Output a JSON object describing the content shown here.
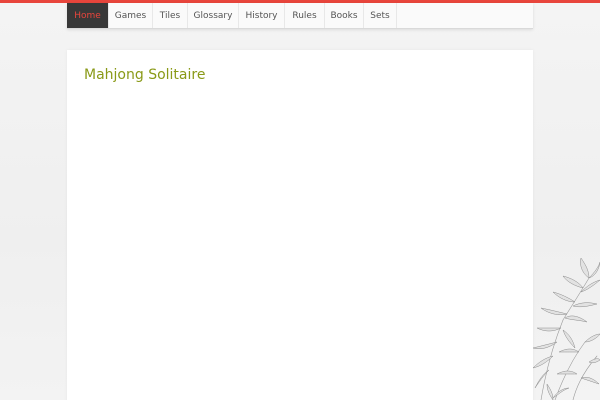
{
  "colors": {
    "accent_red": "#e8453c",
    "title_olive": "#8a9a18",
    "active_tab_bg": "#383838"
  },
  "nav": {
    "items": [
      {
        "label": "Home",
        "active": true
      },
      {
        "label": "Games"
      },
      {
        "label": "Tiles"
      },
      {
        "label": "Glossary"
      },
      {
        "label": "History"
      },
      {
        "label": "Rules"
      },
      {
        "label": "Books"
      },
      {
        "label": "Sets"
      }
    ]
  },
  "main": {
    "title": "Mahjong Solitaire"
  }
}
